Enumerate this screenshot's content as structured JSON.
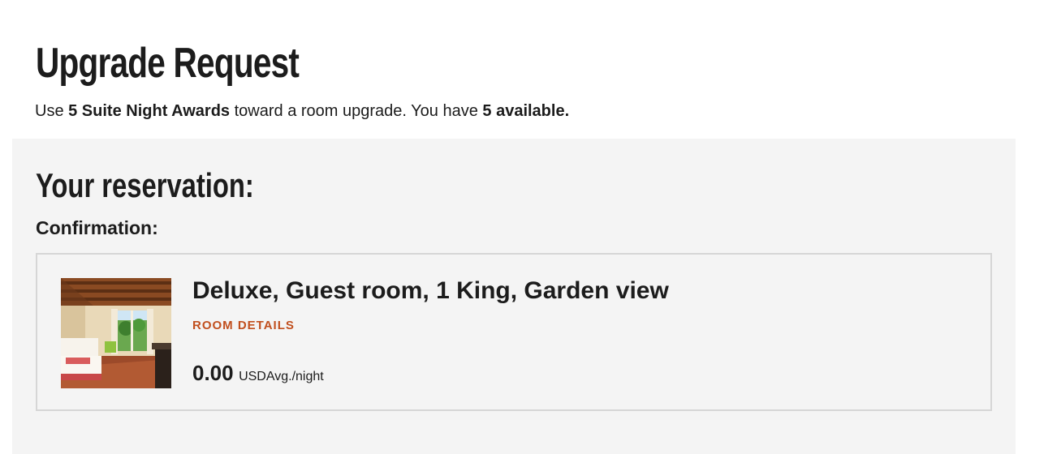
{
  "page": {
    "title": "Upgrade Request",
    "intro": {
      "part1": "Use ",
      "awards": "5 Suite Night Awards",
      "part2": " toward a room upgrade. You have ",
      "available": "5 available."
    }
  },
  "reservation": {
    "heading": "Your reservation:",
    "confirmation_label": "Confirmation:",
    "room": {
      "name": "Deluxe, Guest room, 1 King, Garden view",
      "details_link": "ROOM DETAILS",
      "price": "0.00",
      "price_unit": "USDAvg./night",
      "photo_icon": "hotel-room-photo"
    }
  },
  "colors": {
    "accent": "#c14f1e",
    "panel_bg": "#f4f4f4",
    "card_border": "#d6d6d6",
    "text": "#1c1c1c"
  }
}
